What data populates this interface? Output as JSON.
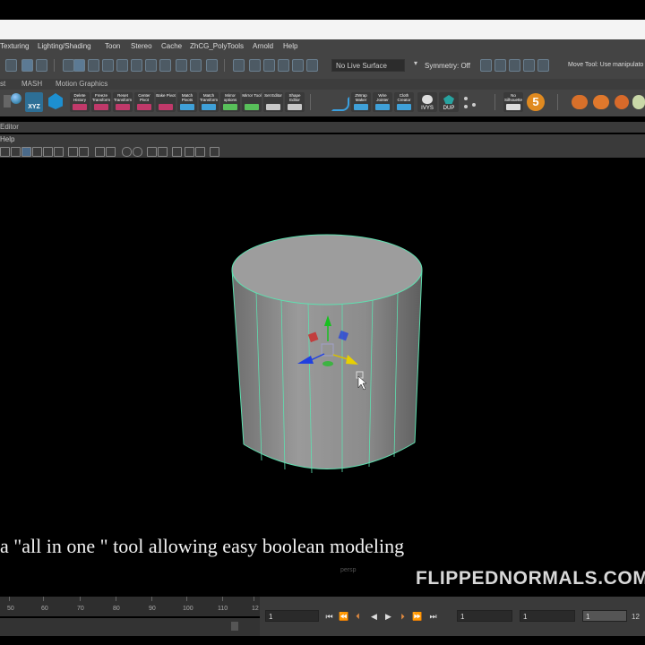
{
  "menubar": {
    "items": [
      "Texturing",
      "Lighting/Shading",
      "Toon",
      "Stereo",
      "Cache",
      "ZhCG_PolyTools",
      "Arnold",
      "Help"
    ]
  },
  "toolbar": {
    "live_surface": "No Live Surface",
    "symmetry": "Symmetry: Off",
    "status_hint": "Move Tool: Use manipulato"
  },
  "shelf_tabs": [
    "st",
    "MASH",
    "Motion Graphics"
  ],
  "shelf": {
    "xyz": "XYZ",
    "buttons": [
      {
        "label": "Delete History",
        "color": "#c0396a"
      },
      {
        "label": "Freeze Transform",
        "color": "#c0396a"
      },
      {
        "label": "Reset Transform",
        "color": "#c0396a"
      },
      {
        "label": "Center Pivot",
        "color": "#c0396a"
      },
      {
        "label": "Bake Pivot",
        "color": "#c0396a"
      },
      {
        "label": "Match Pivots",
        "color": "#3fa0d8"
      },
      {
        "label": "Match Transform",
        "color": "#3fa0d8"
      },
      {
        "label": "Mirror options",
        "color": "#58c05a"
      },
      {
        "label": "Mirror Tool",
        "color": "#58c05a"
      },
      {
        "label": "Set Editor",
        "color": "#c8c8c8"
      },
      {
        "label": "Shape Editor",
        "color": "#c8c8c8"
      }
    ],
    "right_buttons": [
      {
        "label": "ZWrap Maker"
      },
      {
        "label": "Wire Jointer"
      },
      {
        "label": "Cloth Creator"
      }
    ],
    "ivys": "IVYS",
    "dup": "DUP",
    "no_silhouette": "No Silhouette",
    "badge_number": "5"
  },
  "editor_bar": {
    "label": "Editor"
  },
  "viewport_menu": {
    "help": "Help"
  },
  "viewport": {
    "camera": "persp"
  },
  "subtitle": "a \"all in one \" tool allowing easy boolean modeling",
  "watermark": "FLIPPEDNORMALS.COM",
  "timeline": {
    "ticks": [
      "50",
      "60",
      "70",
      "80",
      "90",
      "100",
      "110",
      "12"
    ]
  },
  "playback": {
    "current_frame": "1",
    "range_start": "1",
    "range_inner": "1",
    "anim_start": "1",
    "anim_end": "12"
  },
  "colors": {
    "ui_bg": "#444444",
    "viewport_bg": "#000000",
    "wireframe_highlight": "#5fe0b0",
    "manip_x": "#d02020",
    "manip_y": "#18c020",
    "manip_z": "#2040e0"
  }
}
